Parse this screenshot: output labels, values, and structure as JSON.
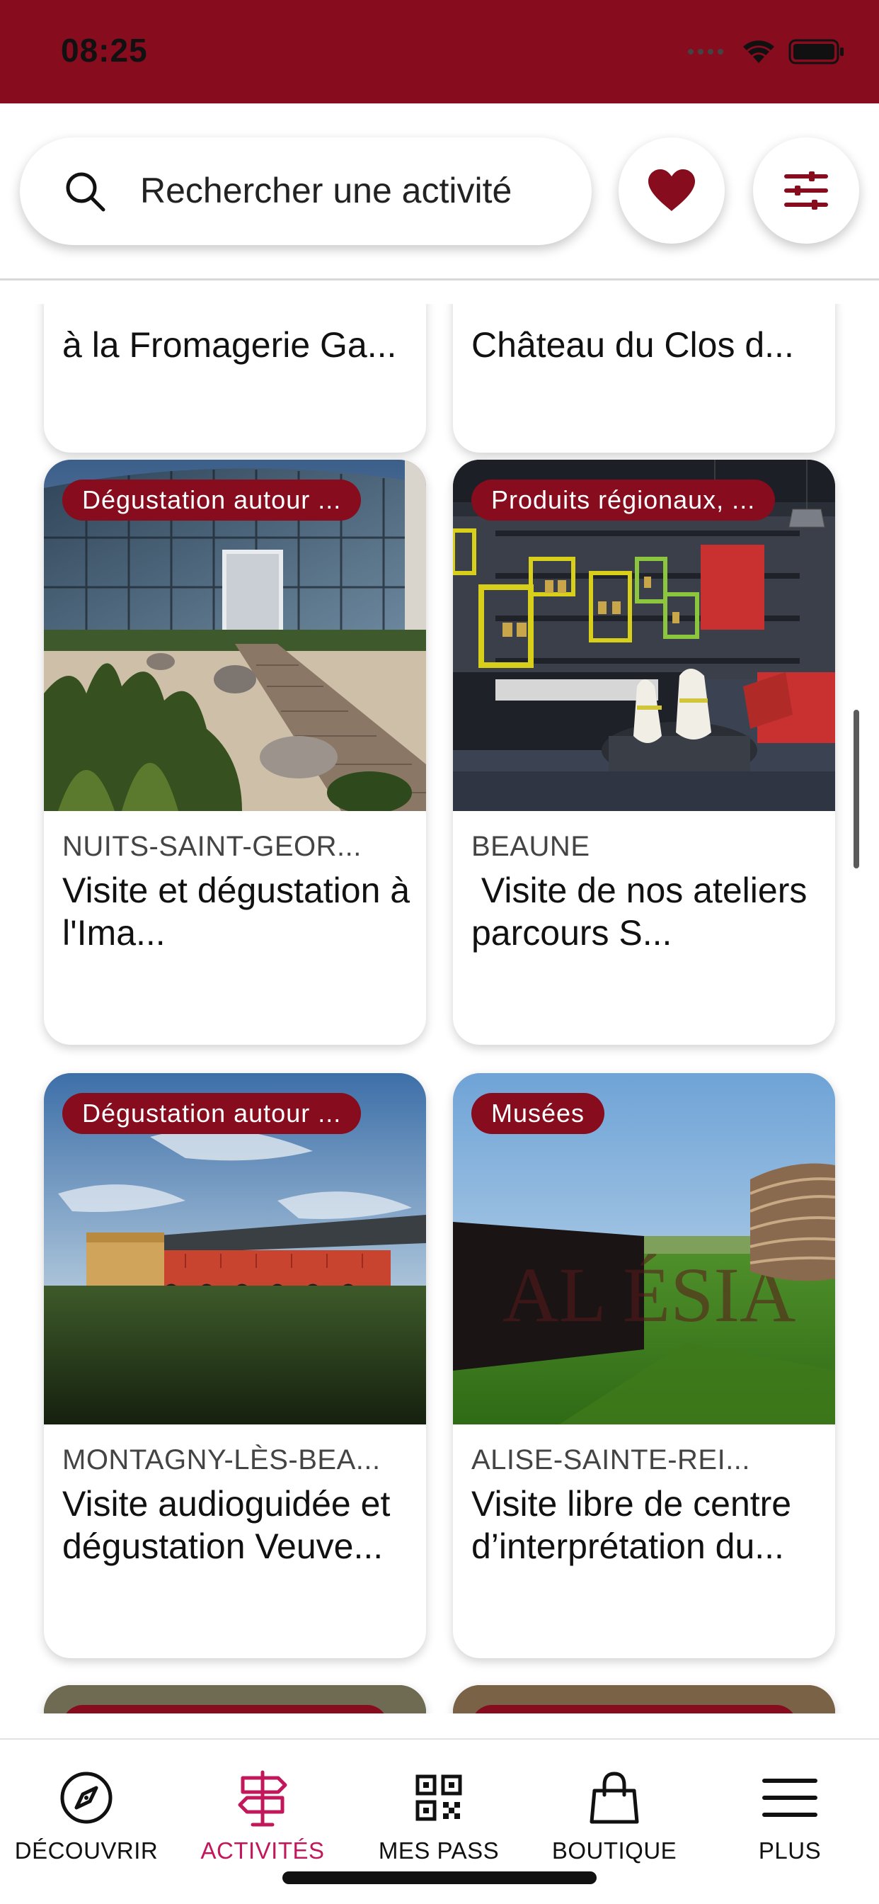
{
  "status_bar": {
    "time": "08:25",
    "background": "#860c1e"
  },
  "search": {
    "placeholder": "Rechercher une activité"
  },
  "header_buttons": {
    "favorites_icon": "heart-icon",
    "filters_icon": "sliders-icon",
    "accent": "#860c1e"
  },
  "cards_partial_top": [
    {
      "title": "à la Fromagerie Ga..."
    },
    {
      "title": "Château du Clos d..."
    }
  ],
  "cards": [
    {
      "badge": "Dégustation  autour ...",
      "location": "NUITS-SAINT-GEOR...",
      "title": "Visite  et dégustation à l'Ima..."
    },
    {
      "badge": "Produits régionaux, ...",
      "location": "BEAUNE",
      "title": " Visite de nos ateliers parcours S..."
    },
    {
      "badge": "Dégustation  autour ...",
      "location": "MONTAGNY-LÈS-BEA...",
      "title": "Visite audioguidée et dégustation Veuve..."
    },
    {
      "badge": "Musées",
      "location": "ALISE-SAINTE-REI...",
      "title": "Visite libre de centre d’interprétation du..."
    }
  ],
  "bottom_nav": {
    "items": [
      {
        "label": "DÉCOUVRIR",
        "icon": "compass-icon",
        "active": false
      },
      {
        "label": "ACTIVITÉS",
        "icon": "signpost-icon",
        "active": true
      },
      {
        "label": "MES PASS",
        "icon": "qr-code-icon",
        "active": false
      },
      {
        "label": "BOUTIQUE",
        "icon": "shopping-bag-icon",
        "active": false
      },
      {
        "label": "PLUS",
        "icon": "menu-icon",
        "active": false
      }
    ],
    "active_color": "#c2185b"
  }
}
